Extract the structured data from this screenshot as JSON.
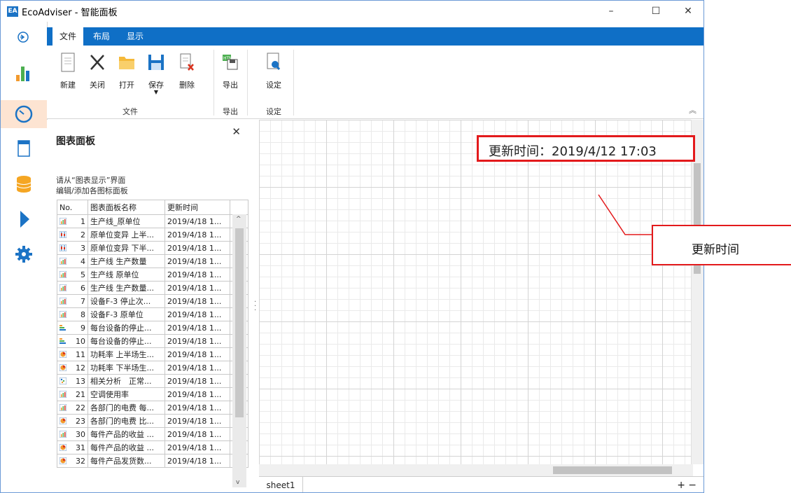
{
  "window": {
    "title": "EcoAdviser - 智能面板",
    "app_icon": "EA"
  },
  "ribbon_tabs": [
    {
      "label": "文件",
      "active": true
    },
    {
      "label": "布局",
      "active": false
    },
    {
      "label": "显示",
      "active": false
    }
  ],
  "ribbon": {
    "file_buttons": [
      {
        "label": "新建",
        "icon": "new-document-icon"
      },
      {
        "label": "关闭",
        "icon": "close-x-icon"
      },
      {
        "label": "打开",
        "icon": "folder-icon"
      },
      {
        "label": "保存",
        "icon": "save-icon"
      },
      {
        "label": "删除",
        "icon": "delete-document-icon"
      }
    ],
    "export_button": {
      "label": "导出",
      "icon": "export-icon"
    },
    "settings_button": {
      "label": "设定",
      "icon": "settings-document-icon"
    },
    "groups": {
      "file": "文件",
      "export": "导出",
      "settings": "设定"
    }
  },
  "panel": {
    "title": "图表面板",
    "hint_line1": "请从“图表显示”界面",
    "hint_line2": "编辑/添加各图标面板",
    "columns": {
      "no": "No.",
      "name": "图表面板名称",
      "time": "更新时间"
    },
    "rows": [
      {
        "icon": "bar",
        "no": "1",
        "name": "生产线_原单位",
        "time": "2019/4/18 1..."
      },
      {
        "icon": "candle",
        "no": "2",
        "name": "原单位变异 上半...",
        "time": "2019/4/18 1..."
      },
      {
        "icon": "candle",
        "no": "3",
        "name": "原单位变异 下半...",
        "time": "2019/4/18 1..."
      },
      {
        "icon": "bar",
        "no": "4",
        "name": "生产线 生产数量",
        "time": "2019/4/18 1..."
      },
      {
        "icon": "bar",
        "no": "5",
        "name": "生产线 原单位",
        "time": "2019/4/18 1..."
      },
      {
        "icon": "bar",
        "no": "6",
        "name": "生产线 生产数量...",
        "time": "2019/4/18 1..."
      },
      {
        "icon": "bar",
        "no": "7",
        "name": "设备F-3 停止次...",
        "time": "2019/4/18 1..."
      },
      {
        "icon": "bar",
        "no": "8",
        "name": "设备F-3 原单位",
        "time": "2019/4/18 1..."
      },
      {
        "icon": "hbar",
        "no": "9",
        "name": "每台设备的停止...",
        "time": "2019/4/18 1..."
      },
      {
        "icon": "hbar",
        "no": "10",
        "name": "每台设备的停止...",
        "time": "2019/4/18 1..."
      },
      {
        "icon": "pie",
        "no": "11",
        "name": "功耗率 上半场生...",
        "time": "2019/4/18 1..."
      },
      {
        "icon": "pie",
        "no": "12",
        "name": "功耗率 下半场生...",
        "time": "2019/4/18 1..."
      },
      {
        "icon": "scatter",
        "no": "13",
        "name": "相关分析　正常...",
        "time": "2019/4/18 1..."
      },
      {
        "icon": "bar",
        "no": "21",
        "name": "空调使用率",
        "time": "2019/4/18 1..."
      },
      {
        "icon": "bar",
        "no": "22",
        "name": "各部门的电费 每...",
        "time": "2019/4/18 1..."
      },
      {
        "icon": "pie",
        "no": "23",
        "name": "各部门的电费 比...",
        "time": "2019/4/18 1..."
      },
      {
        "icon": "bar",
        "no": "30",
        "name": "每件产品的收益 ...",
        "time": "2019/4/18 1..."
      },
      {
        "icon": "pie",
        "no": "31",
        "name": "每件产品的收益 ...",
        "time": "2019/4/18 1..."
      },
      {
        "icon": "pie",
        "no": "32",
        "name": "每件产品发货数...",
        "time": "2019/4/18 1..."
      }
    ]
  },
  "sheet": {
    "tab": "sheet1",
    "add": "+",
    "remove": "−"
  },
  "annotations": {
    "update_time_display": "更新时间：2019/4/12 17:03",
    "callout_label": "更新时间"
  },
  "colors": {
    "accent": "#0f6fc6",
    "highlight": "#e31a1c",
    "nav_active": "#fde4d2"
  }
}
